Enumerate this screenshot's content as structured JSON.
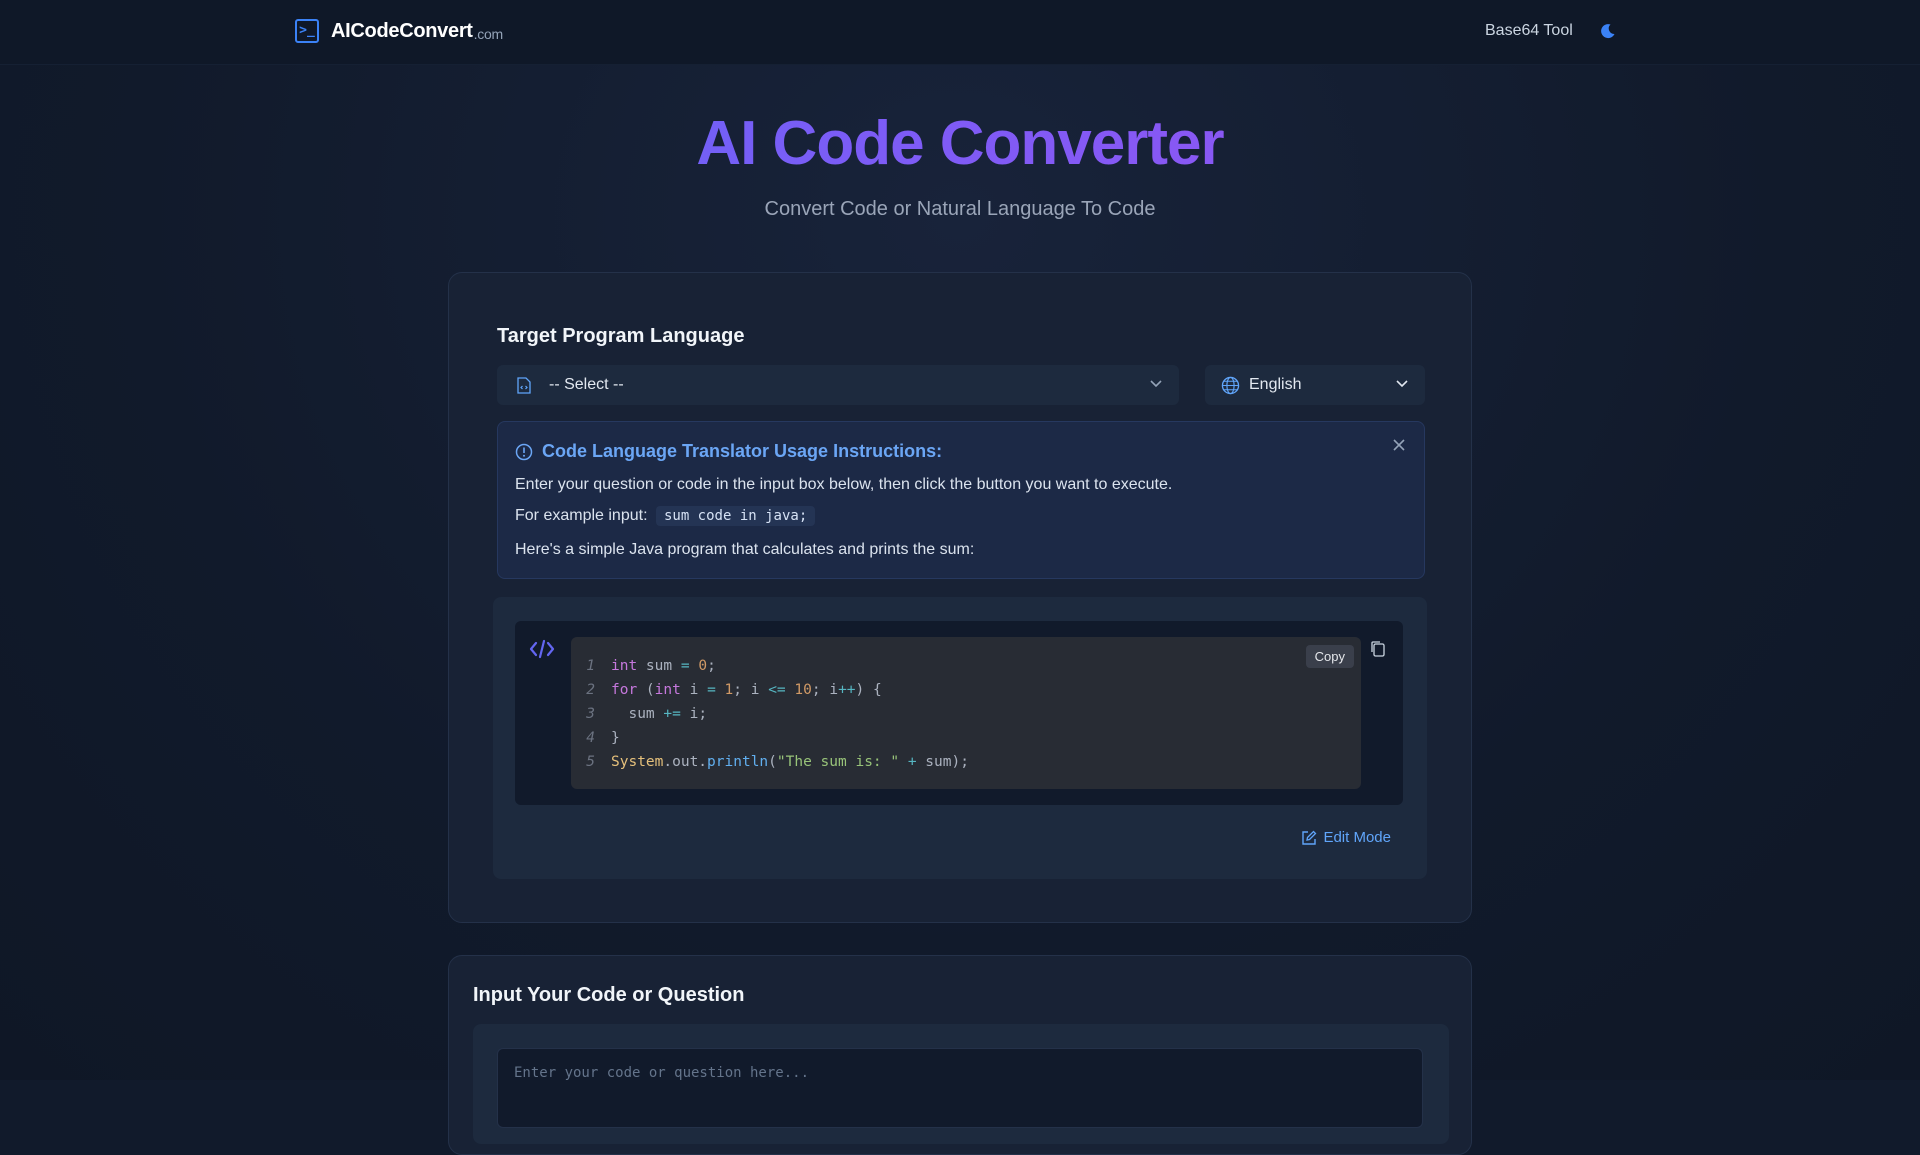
{
  "header": {
    "logo_text": "AICodeConvert",
    "logo_suffix": ".com",
    "nav_link": "Base64 Tool"
  },
  "hero": {
    "title": "AI Code Converter",
    "subtitle": "Convert Code or Natural Language To Code"
  },
  "converter": {
    "section_title": "Target Program Language",
    "language_select": "-- Select --",
    "locale_select": "English",
    "instructions": {
      "title": "Code Language Translator Usage Instructions:",
      "line1": "Enter your question or code in the input box below, then click the button you want to execute.",
      "line2_prefix": "For example input:",
      "line2_code": "sum code in java;",
      "line3": "Here's a simple Java program that calculates and prints the sum:"
    },
    "code_example": {
      "line_numbers": [
        "1",
        "2",
        "3",
        "4",
        "5"
      ],
      "copy_label": "Copy",
      "line1": {
        "kw": "int",
        "rest": " sum ",
        "op": "=",
        "num": "0",
        "end": ";"
      },
      "line2": {
        "kw": "for",
        "p1": " (",
        "kw2": "int",
        "p2": " i ",
        "op": "=",
        "num": "1",
        "p3": "; i ",
        "op2": "<=",
        "num2": "10",
        "p4": "; i",
        "op3": "++",
        "p5": ") {"
      },
      "line3": {
        "p1": "  sum ",
        "op": "+=",
        "p2": " i;"
      },
      "line4": {
        "p1": "}"
      },
      "line5": {
        "cls": "System",
        "p1": ".out.",
        "fn": "println",
        "p2": "(",
        "str": "\"The sum is: \"",
        "p3": " ",
        "op": "+",
        "p4": " sum);"
      }
    },
    "edit_mode_label": "Edit Mode"
  },
  "input_section": {
    "title": "Input Your Code or Question",
    "placeholder": "Enter your code or question here..."
  },
  "colors": {
    "background": "#111a2b",
    "card": "#182235",
    "accent_blue": "#3b82f6",
    "link_blue": "#60a5fa",
    "title_gradient_start": "#4f6ef7",
    "title_gradient_end": "#a24ff0"
  },
  "icons": {
    "logo": "terminal-icon",
    "theme": "moon-icon",
    "language": "file-code-icon",
    "locale": "globe-icon",
    "info": "info-circle-icon",
    "close": "close-icon",
    "code": "code-brackets-icon",
    "clipboard": "clipboard-icon",
    "edit": "edit-icon"
  }
}
